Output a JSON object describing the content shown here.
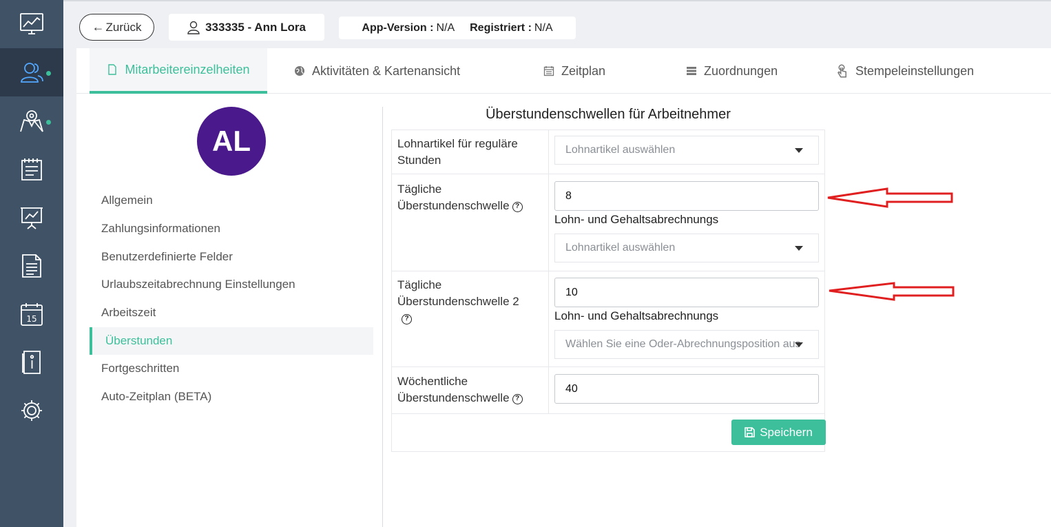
{
  "topbar": {
    "back_label": "Zurück",
    "employee_label": "333335 - Ann Lora",
    "app_version_label": "App-Version :",
    "app_version_value": "N/A",
    "registered_label": "Registriert :",
    "registered_value": "N/A"
  },
  "tabs": [
    {
      "label": "Mitarbeitereinzelheiten",
      "icon": "document-icon",
      "active": true
    },
    {
      "label": "Aktivitäten & Kartenansicht",
      "icon": "globe-icon"
    },
    {
      "label": "Zeitplan",
      "icon": "calendar-icon"
    },
    {
      "label": "Zuordnungen",
      "icon": "list-icon"
    },
    {
      "label": "Stempeleinstellungen",
      "icon": "hand-pointer-icon"
    }
  ],
  "profile": {
    "initials": "AL",
    "avatar_color": "#4a1a8c"
  },
  "menu": [
    {
      "label": "Allgemein"
    },
    {
      "label": "Zahlungsinformationen"
    },
    {
      "label": "Benutzerdefinierte Felder"
    },
    {
      "label": "Urlaubszeitabrechnung Einstellungen"
    },
    {
      "label": "Arbeitszeit"
    },
    {
      "label": "Überstunden",
      "active": true
    },
    {
      "label": "Fortgeschritten"
    },
    {
      "label": "Auto-Zeitplan (BETA)"
    }
  ],
  "form": {
    "title": "Überstundenschwellen für Arbeitnehmer",
    "regular": {
      "label": "Lohnartikel für reguläre Stunden",
      "select_placeholder": "Lohnartikel auswählen"
    },
    "daily": {
      "label": "Tägliche Überstundenschwelle",
      "value": "8",
      "payroll_label": "Lohn- und Gehaltsabrechnungs",
      "select_placeholder": "Lohnartikel auswählen"
    },
    "daily2": {
      "label": "Tägliche Überstundenschwelle 2",
      "value": "10",
      "payroll_label": "Lohn- und Gehaltsabrechnungs",
      "select_placeholder": "Wählen Sie eine Oder-Abrechnungsposition aus"
    },
    "weekly": {
      "label": "Wöchentliche Überstundenschwelle",
      "value": "40"
    },
    "save_label": "Speichern",
    "help_glyph": "?"
  },
  "sidebar": {
    "items": [
      {
        "icon": "dashboard-chart-icon"
      },
      {
        "icon": "users-icon",
        "active": true,
        "dot": true
      },
      {
        "icon": "map-pin-icon",
        "dot": true
      },
      {
        "icon": "notes-icon"
      },
      {
        "icon": "presentation-chart-icon"
      },
      {
        "icon": "report-document-icon"
      },
      {
        "icon": "calendar-15-icon",
        "text": "15"
      },
      {
        "icon": "info-book-icon"
      },
      {
        "icon": "settings-gear-icon"
      }
    ]
  },
  "colors": {
    "accent": "#3dbf9b",
    "sidebar_bg": "#3f5266",
    "sidebar_active": "#2c3a4b",
    "annotation_arrow": "#e02020"
  }
}
